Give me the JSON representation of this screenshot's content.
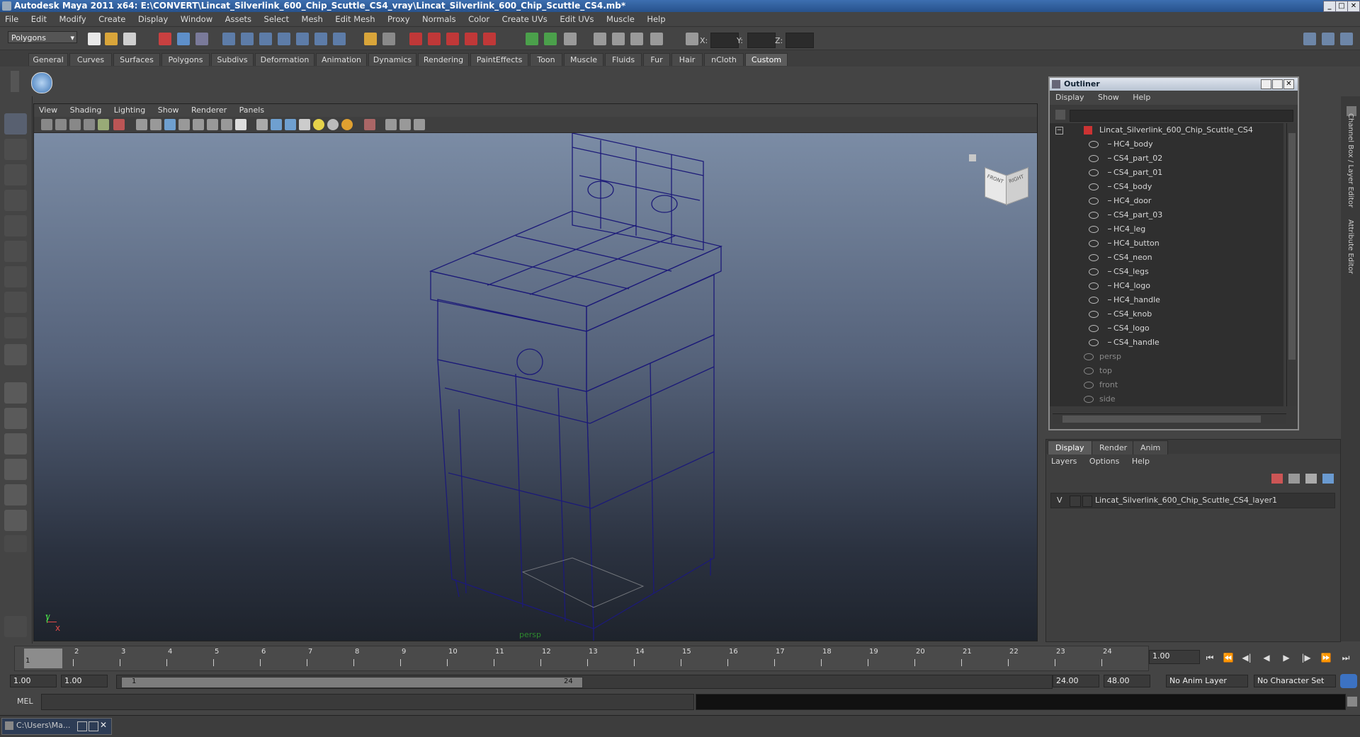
{
  "window": {
    "title": "Autodesk Maya 2011 x64: E:\\CONVERT\\Lincat_Silverlink_600_Chip_Scuttle_CS4_vray\\Lincat_Silverlink_600_Chip_Scuttle_CS4.mb*",
    "min": "_",
    "max": "□",
    "close": "✕"
  },
  "menubar": [
    "File",
    "Edit",
    "Modify",
    "Create",
    "Display",
    "Window",
    "Assets",
    "Select",
    "Mesh",
    "Edit Mesh",
    "Proxy",
    "Normals",
    "Color",
    "Create UVs",
    "Edit UVs",
    "Muscle",
    "Help"
  ],
  "statusline": {
    "mode": "Polygons",
    "x_label": "X:",
    "y_label": "Y:",
    "z_label": "Z:"
  },
  "shelf_tabs": [
    "General",
    "Curves",
    "Surfaces",
    "Polygons",
    "Subdivs",
    "Deformation",
    "Animation",
    "Dynamics",
    "Rendering",
    "PaintEffects",
    "Toon",
    "Muscle",
    "Fluids",
    "Fur",
    "Hair",
    "nCloth",
    "Custom"
  ],
  "shelf_active": "Custom",
  "viewport": {
    "menu": [
      "View",
      "Shading",
      "Lighting",
      "Show",
      "Renderer",
      "Panels"
    ],
    "camera_label": "persp",
    "cube_front": "FRONT",
    "cube_right": "RIGHT",
    "axis_y": "y",
    "axis_x": "x",
    "wire_color": "#1c1a78"
  },
  "outliner": {
    "title": "Outliner",
    "menu": [
      "Display",
      "Show",
      "Help"
    ],
    "root": "Lincat_Silverlink_600_Chip_Scuttle_CS4",
    "children": [
      "HC4_body",
      "CS4_part_02",
      "CS4_part_01",
      "CS4_body",
      "HC4_door",
      "CS4_part_03",
      "HC4_leg",
      "HC4_button",
      "CS4_neon",
      "CS4_legs",
      "HC4_logo",
      "HC4_handle",
      "CS4_knob",
      "CS4_logo",
      "CS4_handle"
    ],
    "cameras": [
      "persp",
      "top",
      "front",
      "side"
    ]
  },
  "layers": {
    "tabs": [
      "Display",
      "Render",
      "Anim"
    ],
    "active_tab": "Display",
    "menu": [
      "Layers",
      "Options",
      "Help"
    ],
    "layer_visible": "V",
    "layer_name": "Lincat_Silverlink_600_Chip_Scuttle_CS4_layer1"
  },
  "side_tabs": [
    "Channel Box / Layer Editor",
    "Attribute Editor"
  ],
  "timeline": {
    "ticks": [
      "1",
      "2",
      "3",
      "4",
      "5",
      "6",
      "7",
      "8",
      "9",
      "10",
      "11",
      "12",
      "13",
      "14",
      "15",
      "16",
      "17",
      "18",
      "19",
      "20",
      "21",
      "22",
      "23",
      "24"
    ],
    "current_marker": "1",
    "current_frame": "1.00"
  },
  "range": {
    "start": "1.00",
    "start2": "1.00",
    "range_start_label": "1",
    "range_end_label": "24",
    "end": "24.00",
    "end2": "48.00",
    "anim_layer": "No Anim Layer",
    "char_set": "No Character Set"
  },
  "cmdline": {
    "label": "MEL"
  },
  "taskbar": {
    "item": "C:\\Users\\Ma..."
  }
}
